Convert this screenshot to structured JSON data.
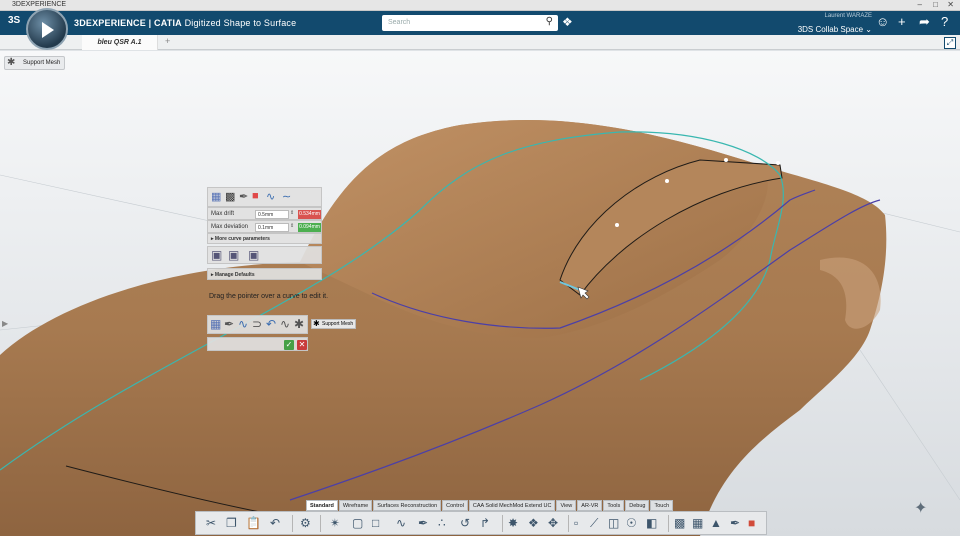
{
  "window": {
    "title": "3DEXPERIENCE",
    "controls": [
      "–",
      "□",
      "✕"
    ]
  },
  "header": {
    "brand_glyph": "3S",
    "app_brand": "3DEXPERIENCE | CATIA",
    "app_name": "Digitized Shape to Surface",
    "search_placeholder": "Search",
    "user_name": "Laurent WARAZE",
    "collab_space": "3DS Collab Space ⌄",
    "icons": [
      "compass-icon",
      "search-icon",
      "tag-icon",
      "user-icon",
      "plus-icon",
      "share-icon",
      "help-icon"
    ]
  },
  "tabs": {
    "items": [
      {
        "label": "bleu QSR A.1"
      }
    ],
    "add": "+"
  },
  "chip": {
    "label": "Support Mesh"
  },
  "panel": {
    "max_drift_label": "Max drift",
    "max_drift_value": "0.5mm",
    "max_drift_result": "0.534mm",
    "max_deviation_label": "Max deviation",
    "max_deviation_value": "0.1mm",
    "max_deviation_result": "0.094mm",
    "more_params": "▸ More curve parameters",
    "manage_defaults": "▸ Manage Defaults",
    "hint": "Drag the pointer over a curve to edit it.",
    "tooltip": "Support Mesh"
  },
  "sections": [
    "Standard",
    "Wireframe",
    "Surfaces Reconstruction",
    "Control",
    "CAA Solid MechMod Extend UC",
    "View",
    "AR-VR",
    "Tools",
    "Debug",
    "Touch"
  ],
  "active_section": "Standard",
  "colors": {
    "topbar": "#124a6e",
    "result_bad": "#d9534f",
    "result_good": "#4caf50",
    "car_body": "#b07f55"
  }
}
